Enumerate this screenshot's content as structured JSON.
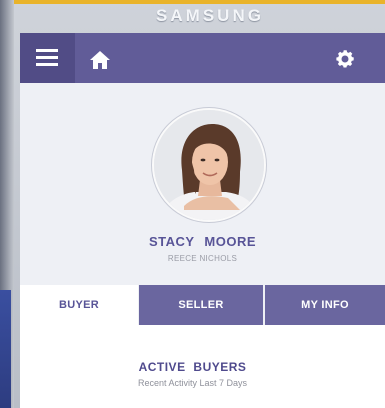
{
  "device": {
    "brand": "SAMSUNG"
  },
  "topbar": {
    "menu_icon": "hamburger-menu-icon",
    "home_icon": "home-icon",
    "settings_icon": "gear-icon",
    "color": "#615c98"
  },
  "profile": {
    "name": "STACY MOORE",
    "company": "REECE NICHOLS",
    "avatar_icon": "profile-photo"
  },
  "tabs": [
    {
      "label": "BUYER",
      "active": true
    },
    {
      "label": "SELLER",
      "active": false
    },
    {
      "label": "MY INFO",
      "active": false
    }
  ],
  "section": {
    "title": "ACTIVE BUYERS",
    "subtitle": "Recent Activity Last 7 Days"
  },
  "colors": {
    "accent": "#615c98",
    "accent_dark": "#514c86",
    "tab_inactive": "#6a669f",
    "title_text": "#585497"
  }
}
